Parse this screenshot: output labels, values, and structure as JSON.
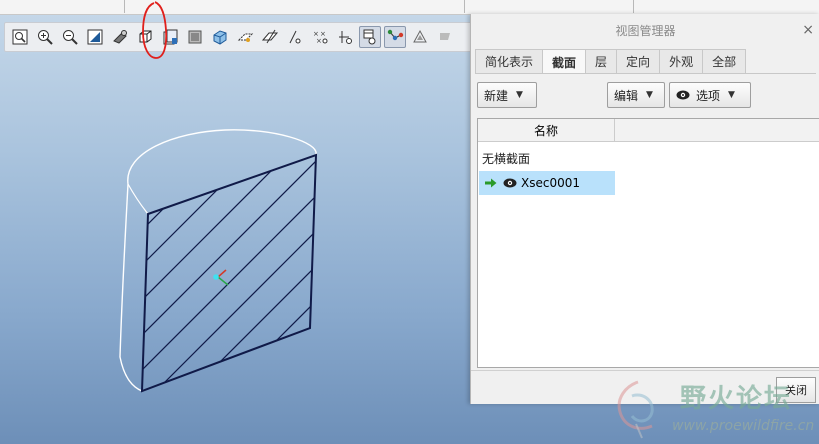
{
  "toolbar": {
    "icons": [
      "zoom-fit-icon",
      "zoom-in-icon",
      "zoom-out-icon",
      "refit-icon",
      "shading-icon",
      "saved-view-icon",
      "layer-icon",
      "appearance-icon",
      "section-icon",
      "datum-plane-icon",
      "datum-axis-icon",
      "datum-point-icon",
      "coord-sys-icon",
      "annotation-icon",
      "spin-center-icon",
      "model-tree-icon",
      "perspective-icon",
      "more-icon"
    ]
  },
  "dialog": {
    "title": "视图管理器",
    "close_glyph": "×",
    "tabs": [
      {
        "label": "简化表示",
        "active": false
      },
      {
        "label": "截面",
        "active": true
      },
      {
        "label": "层",
        "active": false
      },
      {
        "label": "定向",
        "active": false
      },
      {
        "label": "外观",
        "active": false
      },
      {
        "label": "全部",
        "active": false
      }
    ],
    "new_label": "新建",
    "edit_label": "编辑",
    "options_label": "选项",
    "list": {
      "column_name": "名称",
      "no_section": "无横截面",
      "section_name": "Xsec0001"
    },
    "close_button": "关闭"
  },
  "watermark": {
    "text": "野火论坛",
    "url": "www.proewildfire.cn"
  },
  "colors": {
    "selected_row": "#b9e1fb",
    "section_outline": "#101a48",
    "annotation_circle": "#e0201c"
  }
}
